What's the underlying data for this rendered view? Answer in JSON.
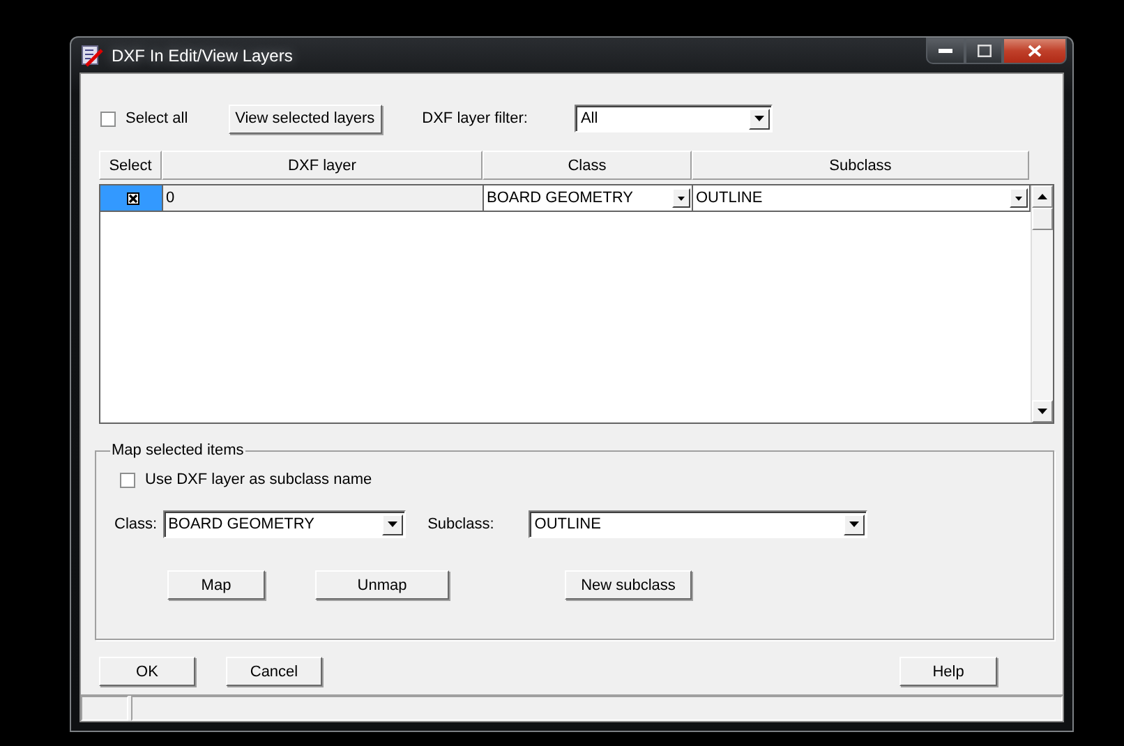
{
  "window": {
    "title": "DXF In Edit/View Layers"
  },
  "toolbar": {
    "select_all": {
      "label": "Select all",
      "checked": false
    },
    "view_button": "View selected layers",
    "filter_label": "DXF layer filter:",
    "filter_value": "All"
  },
  "table": {
    "columns": [
      "Select",
      "DXF layer",
      "Class",
      "Subclass"
    ],
    "rows": [
      {
        "checked": true,
        "selected": true,
        "layer": "0",
        "class": "BOARD GEOMETRY",
        "subclass": "OUTLINE"
      }
    ]
  },
  "map_group": {
    "title": "Map selected items",
    "use_layer": {
      "label": "Use DXF layer as subclass name",
      "checked": false
    },
    "class_label": "Class:",
    "class_value": "BOARD GEOMETRY",
    "subclass_label": "Subclass:",
    "subclass_value": "OUTLINE",
    "buttons": [
      "Map",
      "Unmap",
      "New subclass"
    ]
  },
  "buttons": [
    "OK",
    "Cancel",
    "Help"
  ]
}
